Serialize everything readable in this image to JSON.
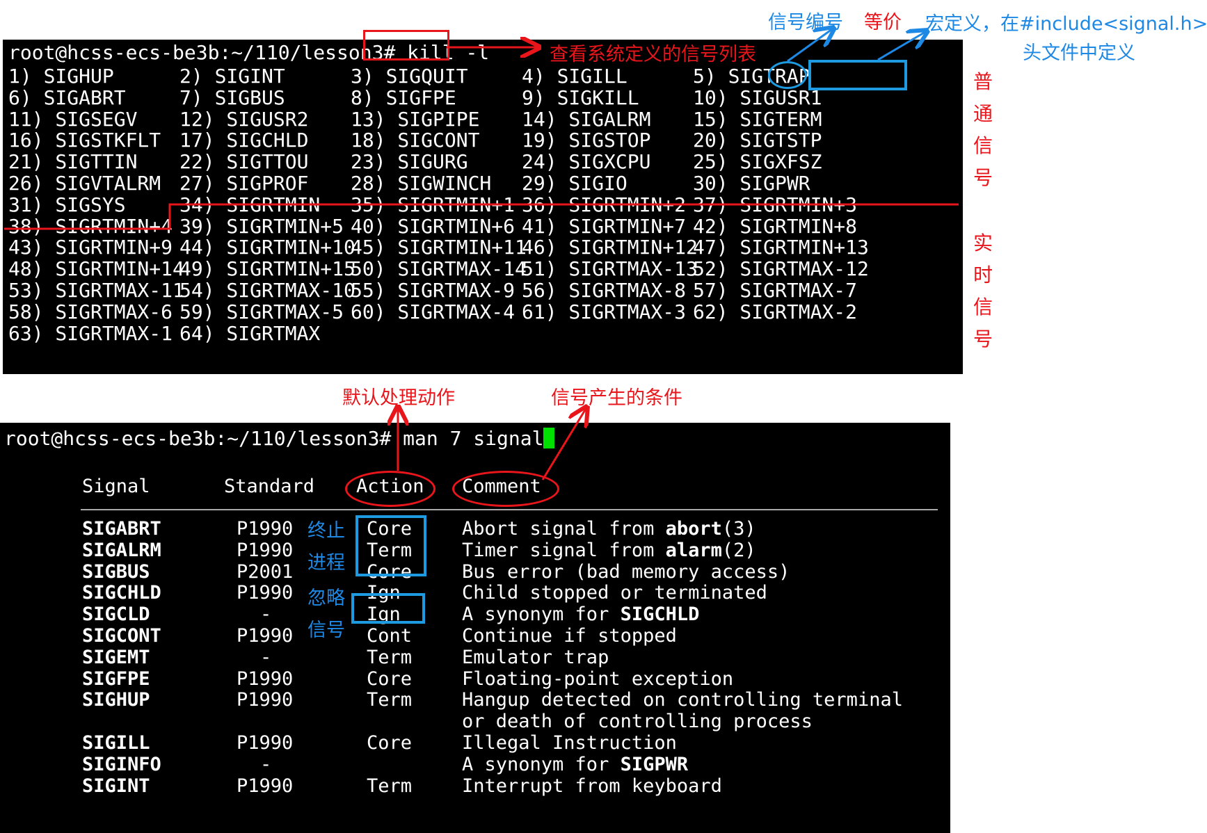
{
  "kill_terminal": {
    "prompt": "root@hcss-ecs-be3b:~/110/lesson3#",
    "command": "kill -l",
    "signals": [
      [
        "1) SIGHUP",
        "2) SIGINT",
        "3) SIGQUIT",
        "4) SIGILL",
        "5) SIGTRAP"
      ],
      [
        "6) SIGABRT",
        "7) SIGBUS",
        "8) SIGFPE",
        "9) SIGKILL",
        "10) SIGUSR1"
      ],
      [
        "11) SIGSEGV",
        "12) SIGUSR2",
        "13) SIGPIPE",
        "14) SIGALRM",
        "15) SIGTERM"
      ],
      [
        "16) SIGSTKFLT",
        "17) SIGCHLD",
        "18) SIGCONT",
        "19) SIGSTOP",
        "20) SIGTSTP"
      ],
      [
        "21) SIGTTIN",
        "22) SIGTTOU",
        "23) SIGURG",
        "24) SIGXCPU",
        "25) SIGXFSZ"
      ],
      [
        "26) SIGVTALRM",
        "27) SIGPROF",
        "28) SIGWINCH",
        "29) SIGIO",
        "30) SIGPWR"
      ],
      [
        "31) SIGSYS",
        "34) SIGRTMIN",
        "35) SIGRTMIN+1",
        "36) SIGRTMIN+2",
        "37) SIGRTMIN+3"
      ],
      [
        "38) SIGRTMIN+4",
        "39) SIGRTMIN+5",
        "40) SIGRTMIN+6",
        "41) SIGRTMIN+7",
        "42) SIGRTMIN+8"
      ],
      [
        "43) SIGRTMIN+9",
        "44) SIGRTMIN+10",
        "45) SIGRTMIN+11",
        "46) SIGRTMIN+12",
        "47) SIGRTMIN+13"
      ],
      [
        "48) SIGRTMIN+14",
        "49) SIGRTMIN+15",
        "50) SIGRTMAX-14",
        "51) SIGRTMAX-13",
        "52) SIGRTMAX-12"
      ],
      [
        "53) SIGRTMAX-11",
        "54) SIGRTMAX-10",
        "55) SIGRTMAX-9",
        "56) SIGRTMAX-8",
        "57) SIGRTMAX-7"
      ],
      [
        "58) SIGRTMAX-6",
        "59) SIGRTMAX-5",
        "60) SIGRTMAX-4",
        "61) SIGRTMAX-3",
        "62) SIGRTMAX-2"
      ],
      [
        "63) SIGRTMAX-1",
        "64) SIGRTMAX",
        "",
        "",
        ""
      ]
    ]
  },
  "man_terminal": {
    "prompt": "root@hcss-ecs-be3b:~/110/lesson3#",
    "command": "man 7 signal",
    "headers": {
      "signal": "Signal",
      "standard": "Standard",
      "action": "Action",
      "comment": "Comment"
    },
    "rows": [
      {
        "name": "SIGABRT",
        "standard": "P1990",
        "action": "Core",
        "comment_pre": "Abort signal from ",
        "comment_bold": "abort",
        "comment_post": "(3)"
      },
      {
        "name": "SIGALRM",
        "standard": "P1990",
        "action": "Term",
        "comment_pre": "Timer signal from ",
        "comment_bold": "alarm",
        "comment_post": "(2)"
      },
      {
        "name": "SIGBUS",
        "standard": "P2001",
        "action": "Core",
        "comment_pre": "Bus error (bad memory access)",
        "comment_bold": "",
        "comment_post": ""
      },
      {
        "name": "SIGCHLD",
        "standard": "P1990",
        "action": "Ign",
        "comment_pre": "Child stopped or terminated",
        "comment_bold": "",
        "comment_post": ""
      },
      {
        "name": "SIGCLD",
        "standard": "-",
        "action": "Ign",
        "comment_pre": "A synonym for ",
        "comment_bold": "SIGCHLD",
        "comment_post": ""
      },
      {
        "name": "SIGCONT",
        "standard": "P1990",
        "action": "Cont",
        "comment_pre": "Continue if stopped",
        "comment_bold": "",
        "comment_post": ""
      },
      {
        "name": "SIGEMT",
        "standard": "-",
        "action": "Term",
        "comment_pre": "Emulator trap",
        "comment_bold": "",
        "comment_post": ""
      },
      {
        "name": "SIGFPE",
        "standard": "P1990",
        "action": "Core",
        "comment_pre": "Floating-point exception",
        "comment_bold": "",
        "comment_post": ""
      },
      {
        "name": "SIGHUP",
        "standard": "P1990",
        "action": "Term",
        "comment_pre": "Hangup detected on controlling terminal",
        "comment_bold": "",
        "comment_post": ""
      },
      {
        "name": "",
        "standard": "",
        "action": "",
        "comment_pre": "or death of controlling process",
        "comment_bold": "",
        "comment_post": ""
      },
      {
        "name": "SIGILL",
        "standard": "P1990",
        "action": "Core",
        "comment_pre": "Illegal Instruction",
        "comment_bold": "",
        "comment_post": ""
      },
      {
        "name": "SIGINFO",
        "standard": "-",
        "action": "",
        "comment_pre": "A synonym for ",
        "comment_bold": "SIGPWR",
        "comment_post": ""
      },
      {
        "name": "SIGINT",
        "standard": "P1990",
        "action": "Term",
        "comment_pre": "Interrupt from keyboard",
        "comment_bold": "",
        "comment_post": ""
      }
    ]
  },
  "annotations": {
    "signal_number": "信号编号",
    "equivalent": "等价",
    "macro_line1": "宏定义，在#include<signal.h>",
    "macro_line2": "头文件中定义",
    "view_list": "查看系统定义的信号列表",
    "normal_signals": [
      "普",
      "通",
      "信",
      "号"
    ],
    "realtime_signals": [
      "实",
      "时",
      "信",
      "号"
    ],
    "default_action": "默认处理动作",
    "signal_condition": "信号产生的条件",
    "terminate_process": [
      "终止",
      "进程"
    ],
    "ignore_signal": [
      "忽略",
      "信号"
    ]
  },
  "colors": {
    "annotation_red": "#e8151b",
    "annotation_blue": "#1e88e5",
    "terminal_bg": "#000000",
    "terminal_fg": "#ffffff",
    "cursor": "#00e000"
  }
}
